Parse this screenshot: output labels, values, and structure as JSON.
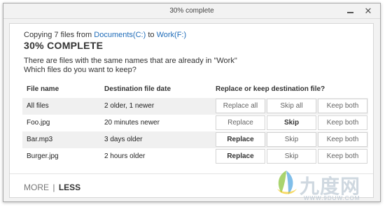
{
  "window": {
    "title": "30% complete",
    "minimize_icon": "minimize-icon",
    "close_glyph": "✕",
    "close_icon": "close-icon"
  },
  "copy": {
    "prefix": "Copying 7 files from",
    "source": "Documents(C:)",
    "to": "to",
    "destination": "Work(F:)"
  },
  "progress": {
    "label": "30% COMPLETE",
    "percent": 30
  },
  "message": {
    "line1": "There are files with the same names that are already in \"Work\"",
    "line2": "Which files do you want to keep?"
  },
  "table": {
    "headers": [
      "File name",
      "Destination file date",
      "Replace or keep destination file?"
    ],
    "rows": [
      {
        "name": "All files",
        "date": "2 older, 1 newer",
        "options": [
          "Replace all",
          "Skip all",
          "Keep both"
        ]
      },
      {
        "name": "Foo.jpg",
        "date": "20 minutes newer",
        "options": [
          "Replace",
          "Skip",
          "Keep both"
        ]
      },
      {
        "name": "Bar.mp3",
        "date": "3 days older",
        "options": [
          "Replace",
          "Skip",
          "Keep both"
        ]
      },
      {
        "name": "Burger.jpg",
        "date": "2 hours older",
        "options": [
          "Replace",
          "Skip",
          "Keep both"
        ]
      }
    ]
  },
  "footer": {
    "more": "MORE",
    "separator": "|",
    "less": "LESS"
  },
  "watermark": {
    "text": "九度网",
    "url": "WWW.9DUW.COM",
    "colors": {
      "green": "#8cc63f",
      "blue": "#4aa3df"
    }
  }
}
